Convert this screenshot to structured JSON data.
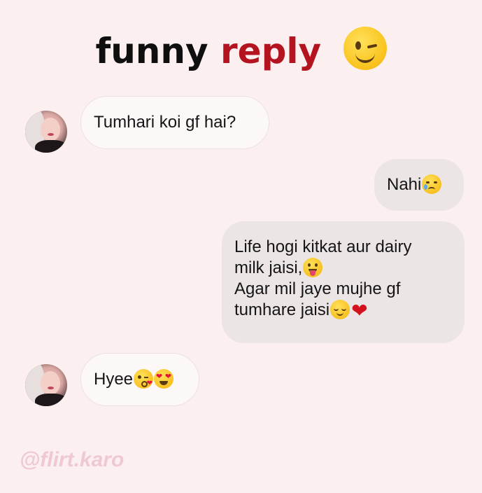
{
  "title": {
    "word1": "funny",
    "word2": "reply",
    "icon": "winking-face-icon"
  },
  "messages": [
    {
      "side": "received",
      "text": "Tumhari koi gf hai?"
    },
    {
      "side": "sent",
      "text": "Nahi",
      "emoji": "crying-face-icon"
    },
    {
      "side": "sent",
      "lines": [
        "Life hogi kitkat aur dairy",
        "milk jaisi,",
        "Agar mil jaye mujhe gf",
        "tumhare jaisi"
      ],
      "emojis": [
        "tongue-out-face-icon",
        "relieved-face-icon",
        "red-heart-icon"
      ]
    },
    {
      "side": "received",
      "text": "Hyee",
      "emojis": [
        "kissing-heart-face-icon",
        "heart-eyes-face-icon"
      ]
    }
  ],
  "watermark": "@flirt.karo",
  "colors": {
    "title_black": "#0f0f0f",
    "title_red": "#b3141f",
    "background": "#fbeff0",
    "sent_bubble": "#ece5e5",
    "received_bubble": "#fdf8f8"
  }
}
